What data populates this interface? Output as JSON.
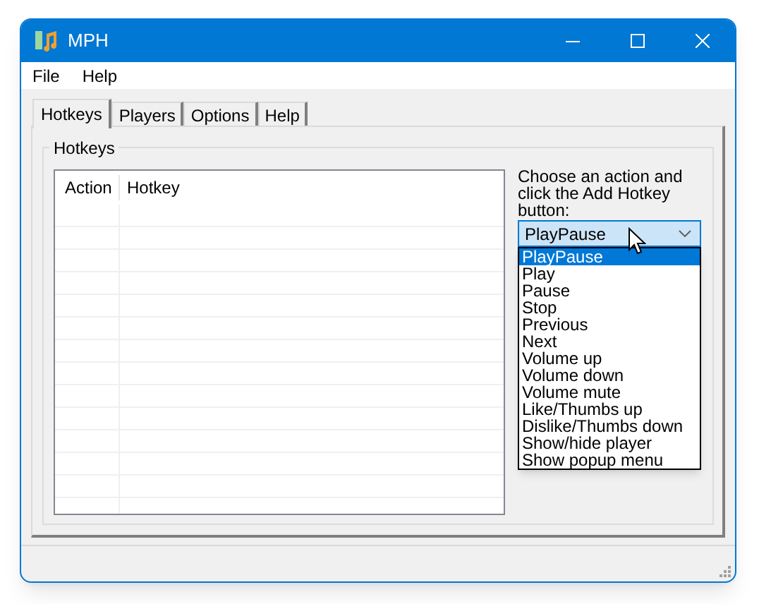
{
  "window": {
    "title": "MPH"
  },
  "menu": [
    "File",
    "Help"
  ],
  "tabs": [
    {
      "label": "Hotkeys",
      "selected": true
    },
    {
      "label": "Players",
      "selected": false
    },
    {
      "label": "Options",
      "selected": false
    },
    {
      "label": "Help",
      "selected": false
    }
  ],
  "group": {
    "title": "Hotkeys"
  },
  "table": {
    "columns": [
      "Action",
      "Hotkey"
    ]
  },
  "instruction": "Choose an action and click the Add Hotkey button:",
  "combo": {
    "value": "PlayPause",
    "expanded": true
  },
  "dropdown": [
    {
      "label": "PlayPause",
      "selected": true
    },
    {
      "label": "Play",
      "selected": false
    },
    {
      "label": "Pause",
      "selected": false
    },
    {
      "label": "Stop",
      "selected": false
    },
    {
      "label": "Previous",
      "selected": false
    },
    {
      "label": "Next",
      "selected": false
    },
    {
      "label": "Volume up",
      "selected": false
    },
    {
      "label": "Volume down",
      "selected": false
    },
    {
      "label": "Volume mute",
      "selected": false
    },
    {
      "label": "Like/Thumbs up",
      "selected": false
    },
    {
      "label": "Dislike/Thumbs down",
      "selected": false
    },
    {
      "label": "Show/hide player",
      "selected": false
    },
    {
      "label": "Show popup menu",
      "selected": false
    }
  ]
}
